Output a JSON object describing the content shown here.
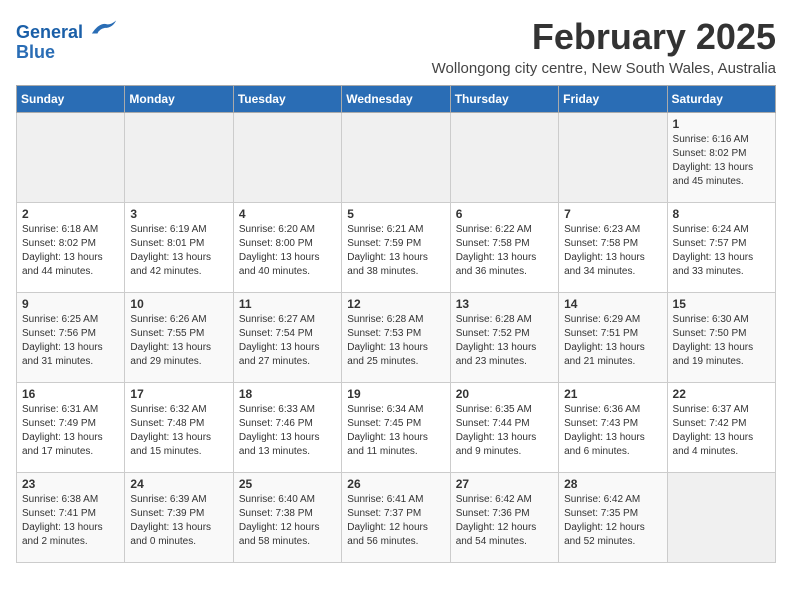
{
  "header": {
    "logo_line1": "General",
    "logo_line2": "Blue",
    "month_title": "February 2025",
    "subtitle": "Wollongong city centre, New South Wales, Australia"
  },
  "weekdays": [
    "Sunday",
    "Monday",
    "Tuesday",
    "Wednesday",
    "Thursday",
    "Friday",
    "Saturday"
  ],
  "weeks": [
    [
      {
        "day": "",
        "info": ""
      },
      {
        "day": "",
        "info": ""
      },
      {
        "day": "",
        "info": ""
      },
      {
        "day": "",
        "info": ""
      },
      {
        "day": "",
        "info": ""
      },
      {
        "day": "",
        "info": ""
      },
      {
        "day": "1",
        "info": "Sunrise: 6:16 AM\nSunset: 8:02 PM\nDaylight: 13 hours\nand 45 minutes."
      }
    ],
    [
      {
        "day": "2",
        "info": "Sunrise: 6:18 AM\nSunset: 8:02 PM\nDaylight: 13 hours\nand 44 minutes."
      },
      {
        "day": "3",
        "info": "Sunrise: 6:19 AM\nSunset: 8:01 PM\nDaylight: 13 hours\nand 42 minutes."
      },
      {
        "day": "4",
        "info": "Sunrise: 6:20 AM\nSunset: 8:00 PM\nDaylight: 13 hours\nand 40 minutes."
      },
      {
        "day": "5",
        "info": "Sunrise: 6:21 AM\nSunset: 7:59 PM\nDaylight: 13 hours\nand 38 minutes."
      },
      {
        "day": "6",
        "info": "Sunrise: 6:22 AM\nSunset: 7:58 PM\nDaylight: 13 hours\nand 36 minutes."
      },
      {
        "day": "7",
        "info": "Sunrise: 6:23 AM\nSunset: 7:58 PM\nDaylight: 13 hours\nand 34 minutes."
      },
      {
        "day": "8",
        "info": "Sunrise: 6:24 AM\nSunset: 7:57 PM\nDaylight: 13 hours\nand 33 minutes."
      }
    ],
    [
      {
        "day": "9",
        "info": "Sunrise: 6:25 AM\nSunset: 7:56 PM\nDaylight: 13 hours\nand 31 minutes."
      },
      {
        "day": "10",
        "info": "Sunrise: 6:26 AM\nSunset: 7:55 PM\nDaylight: 13 hours\nand 29 minutes."
      },
      {
        "day": "11",
        "info": "Sunrise: 6:27 AM\nSunset: 7:54 PM\nDaylight: 13 hours\nand 27 minutes."
      },
      {
        "day": "12",
        "info": "Sunrise: 6:28 AM\nSunset: 7:53 PM\nDaylight: 13 hours\nand 25 minutes."
      },
      {
        "day": "13",
        "info": "Sunrise: 6:28 AM\nSunset: 7:52 PM\nDaylight: 13 hours\nand 23 minutes."
      },
      {
        "day": "14",
        "info": "Sunrise: 6:29 AM\nSunset: 7:51 PM\nDaylight: 13 hours\nand 21 minutes."
      },
      {
        "day": "15",
        "info": "Sunrise: 6:30 AM\nSunset: 7:50 PM\nDaylight: 13 hours\nand 19 minutes."
      }
    ],
    [
      {
        "day": "16",
        "info": "Sunrise: 6:31 AM\nSunset: 7:49 PM\nDaylight: 13 hours\nand 17 minutes."
      },
      {
        "day": "17",
        "info": "Sunrise: 6:32 AM\nSunset: 7:48 PM\nDaylight: 13 hours\nand 15 minutes."
      },
      {
        "day": "18",
        "info": "Sunrise: 6:33 AM\nSunset: 7:46 PM\nDaylight: 13 hours\nand 13 minutes."
      },
      {
        "day": "19",
        "info": "Sunrise: 6:34 AM\nSunset: 7:45 PM\nDaylight: 13 hours\nand 11 minutes."
      },
      {
        "day": "20",
        "info": "Sunrise: 6:35 AM\nSunset: 7:44 PM\nDaylight: 13 hours\nand 9 minutes."
      },
      {
        "day": "21",
        "info": "Sunrise: 6:36 AM\nSunset: 7:43 PM\nDaylight: 13 hours\nand 6 minutes."
      },
      {
        "day": "22",
        "info": "Sunrise: 6:37 AM\nSunset: 7:42 PM\nDaylight: 13 hours\nand 4 minutes."
      }
    ],
    [
      {
        "day": "23",
        "info": "Sunrise: 6:38 AM\nSunset: 7:41 PM\nDaylight: 13 hours\nand 2 minutes."
      },
      {
        "day": "24",
        "info": "Sunrise: 6:39 AM\nSunset: 7:39 PM\nDaylight: 13 hours\nand 0 minutes."
      },
      {
        "day": "25",
        "info": "Sunrise: 6:40 AM\nSunset: 7:38 PM\nDaylight: 12 hours\nand 58 minutes."
      },
      {
        "day": "26",
        "info": "Sunrise: 6:41 AM\nSunset: 7:37 PM\nDaylight: 12 hours\nand 56 minutes."
      },
      {
        "day": "27",
        "info": "Sunrise: 6:42 AM\nSunset: 7:36 PM\nDaylight: 12 hours\nand 54 minutes."
      },
      {
        "day": "28",
        "info": "Sunrise: 6:42 AM\nSunset: 7:35 PM\nDaylight: 12 hours\nand 52 minutes."
      },
      {
        "day": "",
        "info": ""
      }
    ]
  ]
}
